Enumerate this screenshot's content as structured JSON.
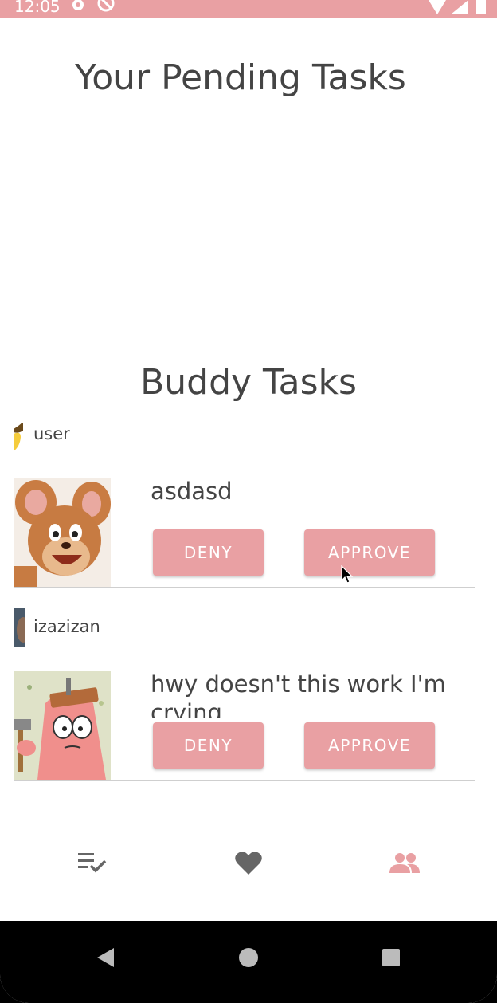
{
  "status_bar": {
    "time": "12:05",
    "icons": [
      "gear-icon",
      "blocked-icon",
      "wifi-icon",
      "signal-icon",
      "battery-icon"
    ]
  },
  "page_title": "Your Pending Tasks",
  "section_title": "Buddy Tasks",
  "tasks": [
    {
      "username": "user",
      "title": "asdasd",
      "deny_label": "DENY",
      "approve_label": "APPROVE"
    },
    {
      "username": "izazizan",
      "title": "hwy doesn't this work I'm crying",
      "deny_label": "DENY",
      "approve_label": "APPROVE"
    }
  ],
  "bottom_nav": {
    "items": [
      "tasks-icon",
      "heart-icon",
      "buddies-icon"
    ],
    "active_index": 2
  },
  "colors": {
    "accent": "#e9a0a3",
    "text": "#444444",
    "nav_inactive": "#666666"
  }
}
